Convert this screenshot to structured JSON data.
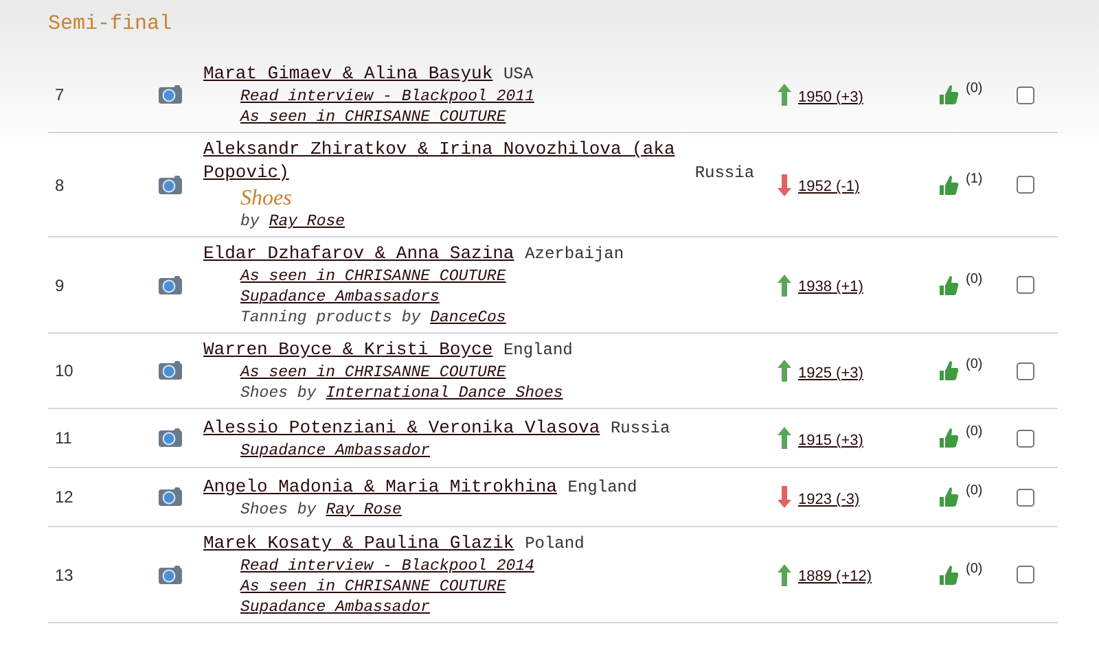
{
  "section_title": "Semi-final",
  "rows": [
    {
      "rank": "7",
      "name": "Marat Gimaev & Alina Basyuk",
      "country": "USA",
      "lines": [
        {
          "kind": "link",
          "text": "Read interview - Blackpool 2011"
        },
        {
          "kind": "link",
          "text": "As seen in CHRISANNE COUTURE"
        }
      ],
      "rising": true,
      "score": "1950 (+3)",
      "likes": "(0)",
      "checked": false
    },
    {
      "rank": "8",
      "name": "Aleksandr Zhiratkov & Irina Novozhilova (aka Popovic)",
      "country": "Russia",
      "lines": [
        {
          "kind": "brand",
          "text": "Shoes"
        },
        {
          "kind": "credit",
          "prefix": "by",
          "link": "Ray Rose"
        }
      ],
      "rising": false,
      "score": "1952 (-1)",
      "likes": "(1)",
      "checked": false
    },
    {
      "rank": "9",
      "name": "Eldar Dzhafarov & Anna Sazina",
      "country": "Azerbaijan",
      "lines": [
        {
          "kind": "link",
          "text": "As seen in CHRISANNE COUTURE"
        },
        {
          "kind": "link",
          "text": "Supadance Ambassadors"
        },
        {
          "kind": "credit",
          "prefix": "Tanning products by",
          "link": "DanceCos"
        }
      ],
      "rising": true,
      "score": "1938 (+1)",
      "likes": "(0)",
      "checked": false
    },
    {
      "rank": "10",
      "name": "Warren Boyce & Kristi Boyce",
      "country": "England",
      "lines": [
        {
          "kind": "link",
          "text": "As seen in CHRISANNE COUTURE"
        },
        {
          "kind": "credit",
          "prefix": "Shoes by",
          "link": "International Dance Shoes"
        }
      ],
      "rising": true,
      "score": "1925 (+3)",
      "likes": "(0)",
      "checked": false
    },
    {
      "rank": "11",
      "name": "Alessio Potenziani & Veronika Vlasova",
      "country": "Russia",
      "lines": [
        {
          "kind": "link",
          "text": "Supadance Ambassador"
        }
      ],
      "rising": true,
      "score": "1915 (+3)",
      "likes": "(0)",
      "checked": false
    },
    {
      "rank": "12",
      "name": "Angelo Madonia & Maria Mitrokhina",
      "country": "England",
      "lines": [
        {
          "kind": "credit",
          "prefix": "Shoes by",
          "link": "Ray Rose"
        }
      ],
      "rising": false,
      "score": "1923 (-3)",
      "likes": "(0)",
      "checked": false
    },
    {
      "rank": "13",
      "name": "Marek Kosaty & Paulina Glazik",
      "country": "Poland",
      "lines": [
        {
          "kind": "link",
          "text": "Read interview - Blackpool 2014"
        },
        {
          "kind": "link",
          "text": "As seen in CHRISANNE COUTURE"
        },
        {
          "kind": "link",
          "text": "Supadance Ambassador"
        }
      ],
      "rising": true,
      "score": "1889 (+12)",
      "likes": "(0)",
      "checked": false
    }
  ]
}
